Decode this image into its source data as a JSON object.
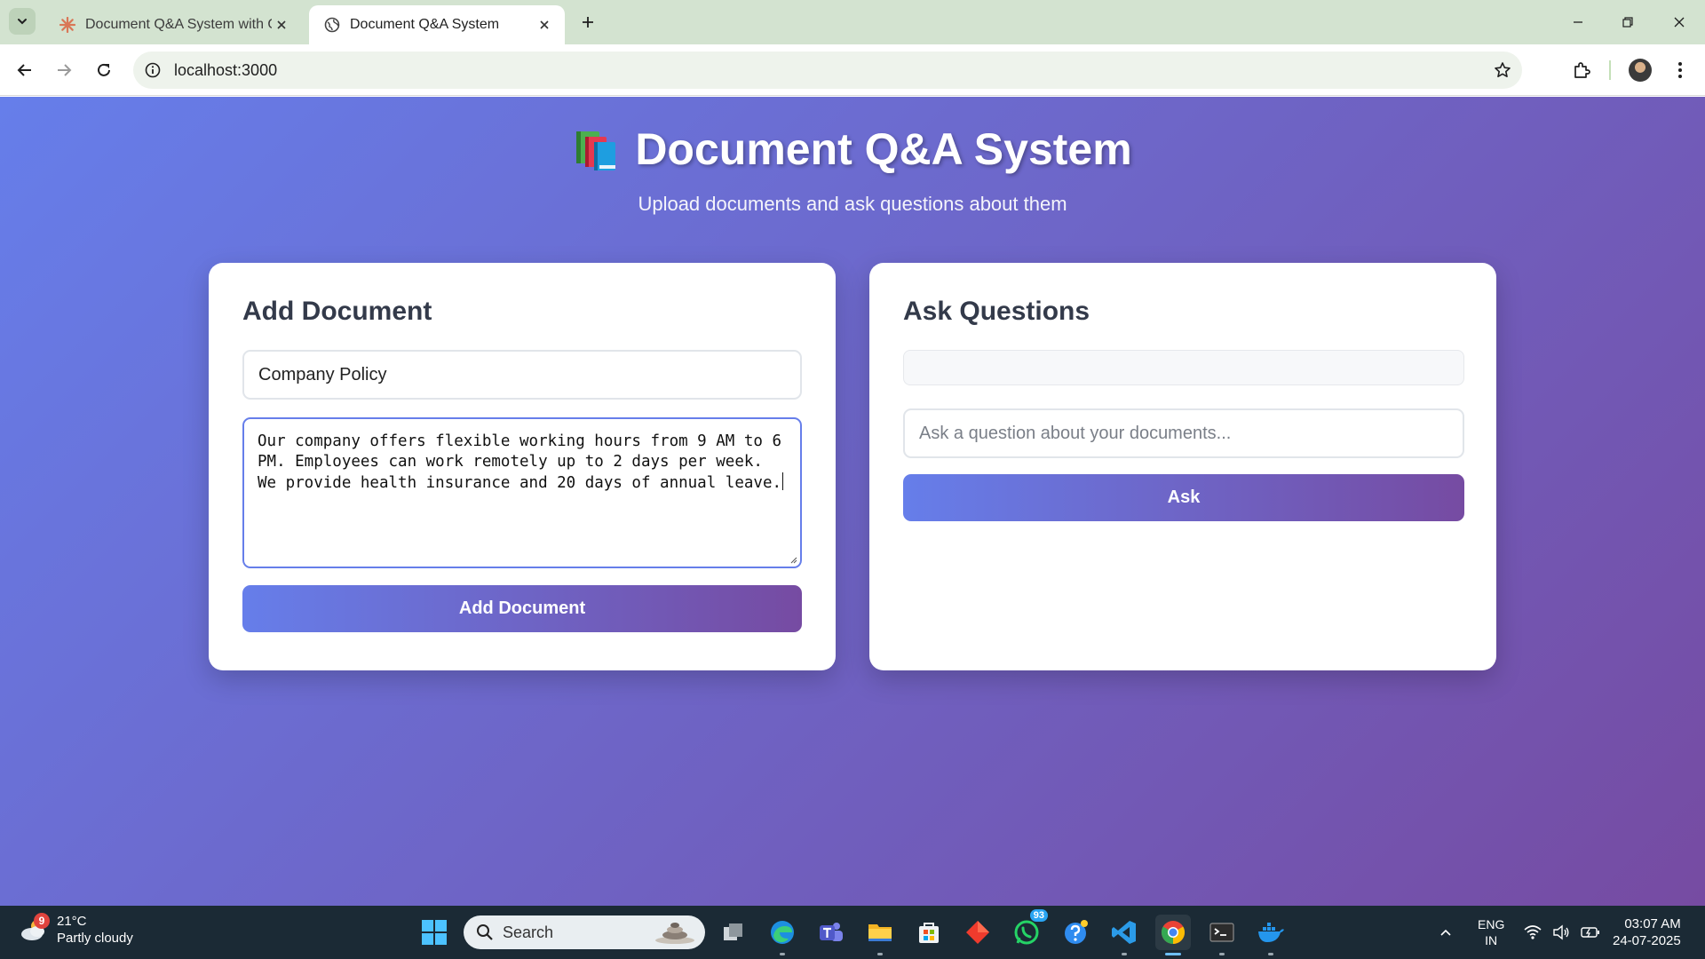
{
  "browser": {
    "tabs": [
      {
        "title": "Document Q&A System with Q",
        "active": false
      },
      {
        "title": "Document Q&A System",
        "active": true
      }
    ],
    "url": "localhost:3000"
  },
  "page": {
    "title": "Document Q&A System",
    "subtitle": "Upload documents and ask questions about them",
    "add_document": {
      "heading": "Add Document",
      "title_value": "Company Policy",
      "content_value": "Our company offers flexible working hours from 9 AM to 6 PM. Employees can work remotely up to 2 days per week. We provide health insurance and 20 days of annual leave.",
      "button_label": "Add Document"
    },
    "ask_questions": {
      "heading": "Ask Questions",
      "question_placeholder": "Ask a question about your documents...",
      "button_label": "Ask"
    },
    "colors": {
      "gradient_start": "#667eea",
      "gradient_end": "#764ba2"
    }
  },
  "taskbar": {
    "weather": {
      "temp": "21°C",
      "condition": "Partly cloudy",
      "badge": "9"
    },
    "search_label": "Search",
    "whatsapp_badge": "93",
    "language": {
      "line1": "ENG",
      "line2": "IN"
    },
    "time": "03:07 AM",
    "date": "24-07-2025"
  }
}
